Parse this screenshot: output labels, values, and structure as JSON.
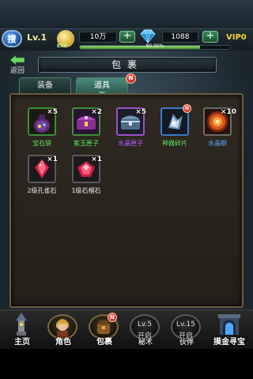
{
  "top_bar": {
    "search_glyph": "搜",
    "level": "Lv.1",
    "exp_label": "EXP",
    "coins": "10万",
    "gems": "1088",
    "plus": "+",
    "exp_percent_text": "80.00%",
    "exp_fraction": 0.8,
    "vip": "VIP0"
  },
  "header": {
    "back_label": "返回",
    "title": "包裹"
  },
  "tabs": [
    {
      "label": "装备",
      "selected": false
    },
    {
      "label": "道具",
      "selected": true,
      "badge": "N"
    }
  ],
  "inventory": [
    {
      "name": "宝石袋",
      "count": "×5",
      "rarity": "green",
      "icon": "gem-bag-icon"
    },
    {
      "name": "紫玉匣子",
      "count": "×2",
      "rarity": "green",
      "icon": "purple-jade-box-icon"
    },
    {
      "name": "水晶匣子",
      "count": "×5",
      "rarity": "purple",
      "icon": "crystal-chest-icon"
    },
    {
      "name": "神器碎片",
      "count": "",
      "rarity": "green",
      "icon": "artifact-fragment-icon",
      "badge": "N"
    },
    {
      "name": "水晶眼",
      "count": "×10",
      "rarity": "blue",
      "icon": "crystal-eye-icon"
    },
    {
      "name": "2级孔雀石",
      "count": "×1",
      "rarity": "white",
      "icon": "peacock-stone-icon"
    },
    {
      "name": "1级石榴石",
      "count": "×1",
      "rarity": "white",
      "icon": "garnet-icon"
    }
  ],
  "bottom_nav": [
    {
      "label": "主页",
      "icon": "home-tower-icon"
    },
    {
      "label": "角色",
      "icon": "character-portrait-icon"
    },
    {
      "label": "包裹",
      "icon": "bag-icon",
      "badge": "N"
    },
    {
      "label": "秘术",
      "level": "Lv.5",
      "open_text": "开启",
      "icon": "lock-icon"
    },
    {
      "label": "伙伴",
      "level": "Lv.15",
      "open_text": "开启",
      "icon": "lock-icon"
    },
    {
      "label": "摸金寻宝",
      "icon": "treasure-gate-icon"
    }
  ],
  "colors": {
    "rarity_green": "#5fe25a",
    "rarity_blue": "#59a8ff",
    "rarity_white": "#e8e8e8",
    "vip_gold": "#f2d53c",
    "badge_red": "#d21a1a"
  }
}
